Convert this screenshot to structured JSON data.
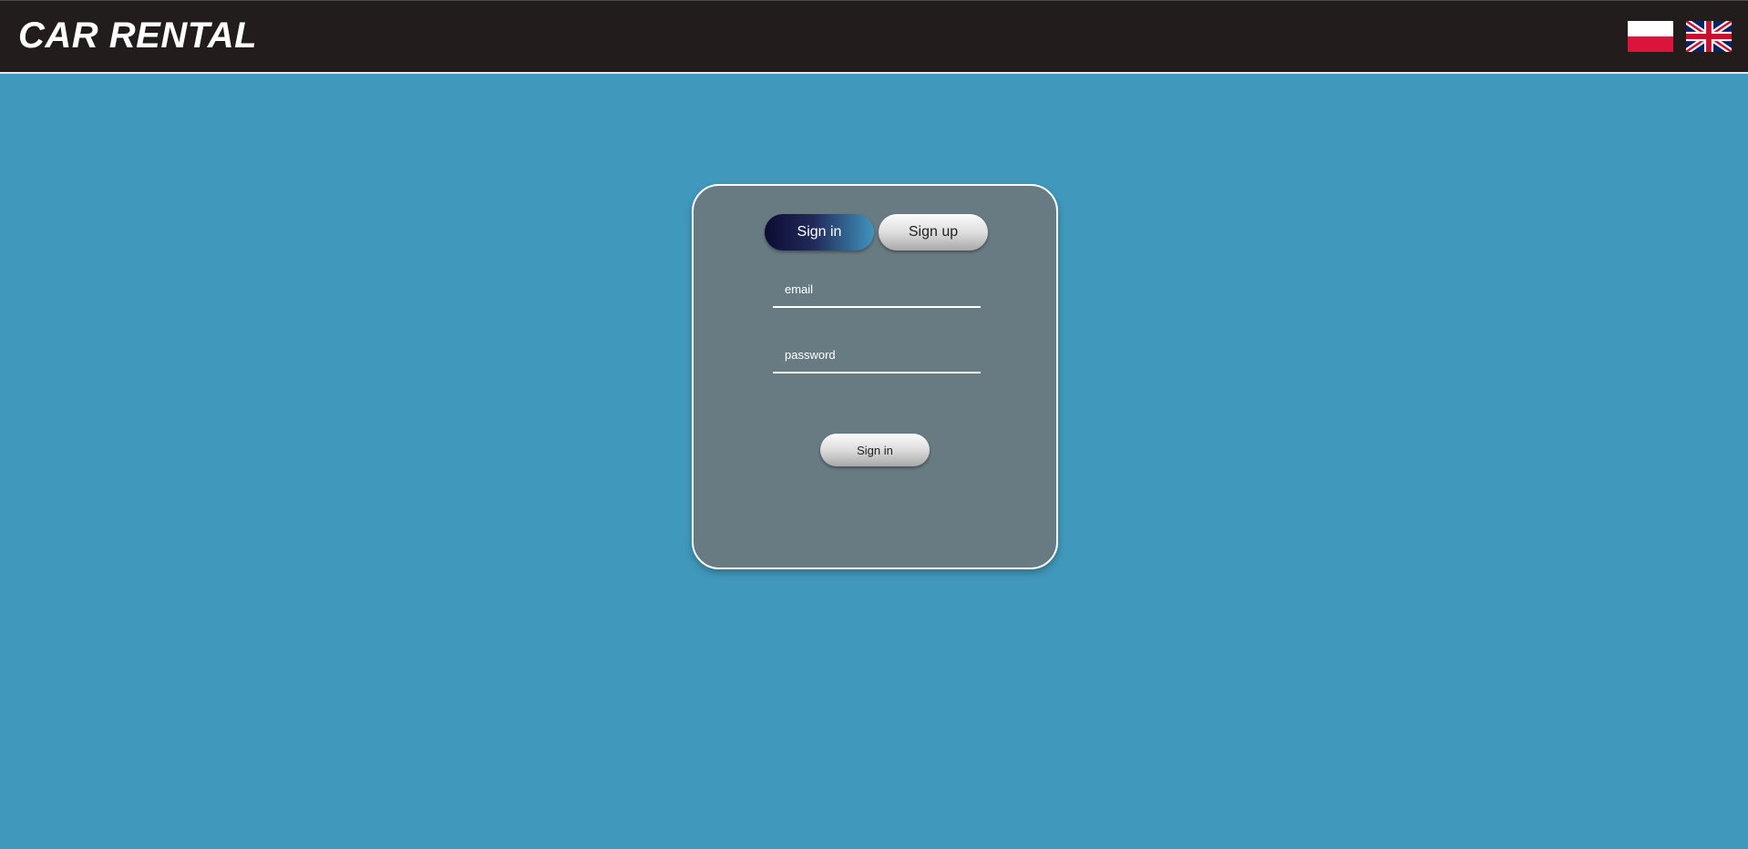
{
  "header": {
    "brand": "CAR RENTAL",
    "languages": [
      {
        "code": "pl",
        "icon": "poland-flag-icon"
      },
      {
        "code": "en",
        "icon": "uk-flag-icon"
      }
    ]
  },
  "auth": {
    "tabs": [
      {
        "label": "Sign in",
        "active": true
      },
      {
        "label": "Sign up",
        "active": false
      }
    ],
    "email_placeholder": "email",
    "password_placeholder": "password",
    "submit_label": "Sign in"
  },
  "colors": {
    "page_background": "#4098bc",
    "header_background": "#221c1c",
    "card_background": "#687a82",
    "active_tab_gradient_start": "#0c0c33",
    "active_tab_gradient_end": "#3f94bd"
  }
}
